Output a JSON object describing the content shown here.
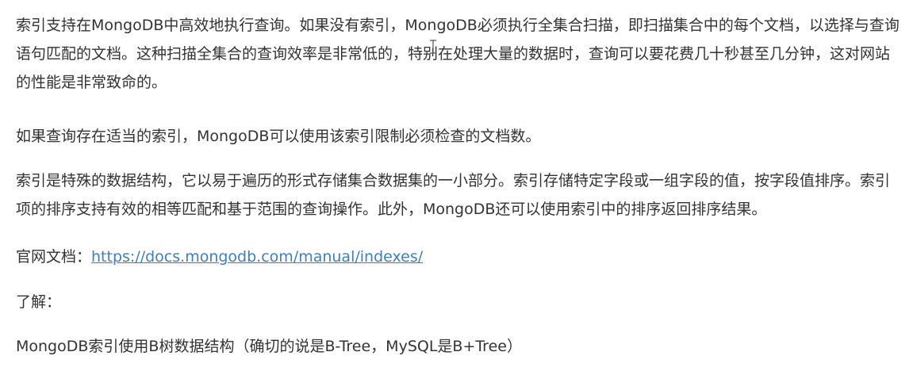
{
  "article": {
    "para1": "索引支持在MongoDB中高效地执行查询。如果没有索引，MongoDB必须执行全集合扫描，即扫描集合中的每个文档，以选择与查询语句匹配的文档。这种扫描全集合的查询效率是非常低的，特别在处理大量的数据时，查询可以要花费几十秒甚至几分钟，这对网站的性能是非常致命的。",
    "para2": "如果查询存在适当的索引，MongoDB可以使用该索引限制必须检查的文档数。",
    "para3": "索引是特殊的数据结构，它以易于遍历的形式存储集合数据集的一小部分。索引存储特定字段或一组字段的值，按字段值排序。索引项的排序支持有效的相等匹配和基于范围的查询操作。此外，MongoDB还可以使用索引中的排序返回排序结果。",
    "doc_label": "官网文档：",
    "doc_url": "https://docs.mongodb.com/manual/indexes/",
    "understand_label": "了解：",
    "para_last": "MongoDB索引使用B树数据结构（确切的说是B-Tree，MySQL是B+Tree）"
  },
  "colors": {
    "text": "#333333",
    "link": "#3f7fbf",
    "background": "#ffffff"
  },
  "icons": {
    "cursor": "text-cursor-icon"
  }
}
